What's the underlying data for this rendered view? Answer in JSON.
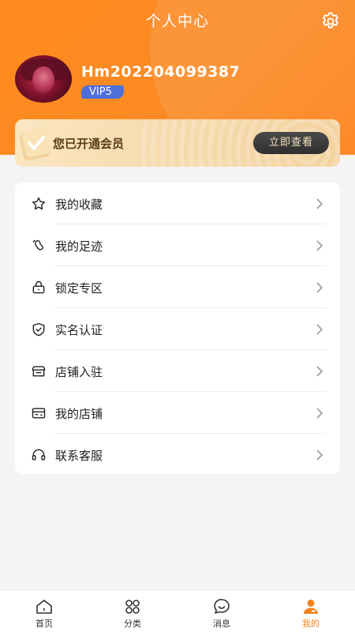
{
  "header": {
    "title": "个人中心"
  },
  "profile": {
    "username": "Hm20220409938​7",
    "vip_level": "VIP5"
  },
  "vip_card": {
    "text": "您已开通会员",
    "button_label": "立即查看"
  },
  "menu": {
    "items": [
      {
        "label": "我的收藏",
        "icon": "star-icon"
      },
      {
        "label": "我的足迹",
        "icon": "footprint-icon"
      },
      {
        "label": "锁定专区",
        "icon": "lock-icon"
      },
      {
        "label": "实名认证",
        "icon": "shield-check-icon"
      },
      {
        "label": "店铺入驻",
        "icon": "store-icon"
      },
      {
        "label": "我的店铺",
        "icon": "my-store-icon"
      },
      {
        "label": "联系客服",
        "icon": "headset-icon"
      }
    ]
  },
  "tabbar": {
    "tabs": [
      {
        "label": "首页",
        "icon": "home-icon"
      },
      {
        "label": "分类",
        "icon": "category-icon"
      },
      {
        "label": "消息",
        "icon": "message-icon"
      },
      {
        "label": "我的",
        "icon": "user-icon",
        "active": true
      }
    ]
  },
  "colors": {
    "accent": "#f2821f",
    "header": "#ff8a1e",
    "vip_badge": "#4f6fd8"
  }
}
